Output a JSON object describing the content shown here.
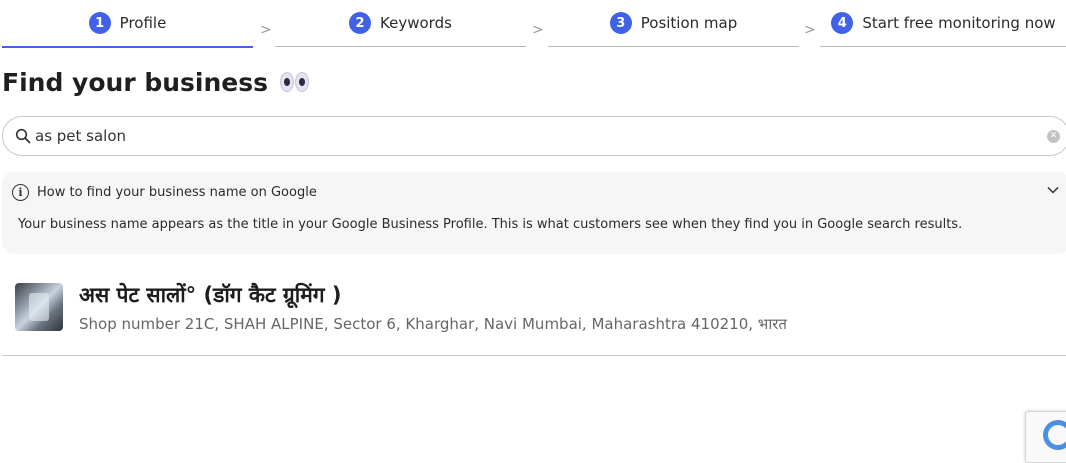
{
  "stepper": {
    "steps": [
      {
        "number": "1",
        "label": "Profile",
        "active": true
      },
      {
        "number": "2",
        "label": "Keywords",
        "active": false
      },
      {
        "number": "3",
        "label": "Position map",
        "active": false
      },
      {
        "number": "4",
        "label": "Start free monitoring now",
        "active": false
      }
    ],
    "separator": ">"
  },
  "page": {
    "title": "Find your business",
    "title_emoji": "eyes-icon"
  },
  "search": {
    "value": "as pet salon",
    "placeholder": "",
    "icon": "search-icon",
    "clear_icon": "clear-icon"
  },
  "help": {
    "title": "How to find your business name on Google",
    "body": "Your business name appears as the title in your Google Business Profile. This is what customers see when they find you in Google search results.",
    "expanded": true
  },
  "results": [
    {
      "name": "अस पेट सालों° (डॉग कैट ग्रूमिंग )",
      "address": "Shop number 21C, SHAH ALPINE, Sector 6, Kharghar, Navi Mumbai, Maharashtra 410210, भारत"
    }
  ],
  "colors": {
    "accent": "#3f62e8",
    "panel_bg": "#f6f6f6",
    "border": "#c8c8c8"
  }
}
